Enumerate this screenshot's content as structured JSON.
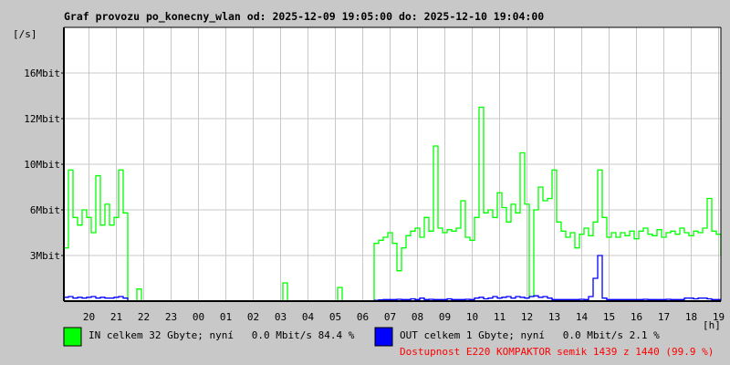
{
  "chart_data": {
    "type": "line",
    "title": "Graf provozu po_konecny_wlan od: 2025-12-09 19:05:00 do: 2025-12-10 19:04:00",
    "ylabel": "[/s]",
    "xlabel": "[h]",
    "yticks": [
      {
        "value": 3,
        "label": "3Mbit"
      },
      {
        "value": 6,
        "label": "6Mbit"
      },
      {
        "value": 10,
        "label": "10Mbit"
      },
      {
        "value": 12,
        "label": "12Mbit"
      },
      {
        "value": 16,
        "label": "16Mbit"
      }
    ],
    "ylim": [
      0,
      20
    ],
    "xticks": [
      "20",
      "21",
      "22",
      "23",
      "00",
      "01",
      "02",
      "03",
      "04",
      "05",
      "06",
      "07",
      "08",
      "09",
      "10",
      "11",
      "12",
      "13",
      "14",
      "15",
      "16",
      "17",
      "18",
      "19"
    ],
    "start_time": "19:05",
    "interval_min": 10,
    "grid": true,
    "series": [
      {
        "name": "IN",
        "color": "#00ff00",
        "values": [
          3.5,
          9.5,
          5.5,
          5,
          6,
          5.5,
          4.5,
          9,
          5,
          6.5,
          5,
          5.5,
          9.5,
          5.8,
          0,
          0,
          0.8,
          0,
          0,
          0,
          0,
          0,
          0,
          0,
          0,
          0,
          0,
          0,
          0,
          0,
          0,
          0,
          0,
          0,
          0,
          0,
          0,
          0,
          0,
          0,
          0,
          0,
          0,
          0,
          0,
          0,
          0,
          0,
          1.2,
          0,
          0,
          0,
          0,
          0,
          0,
          0,
          0,
          0,
          0,
          0,
          0.9,
          0,
          0,
          0,
          0,
          0,
          0,
          0,
          3.8,
          4,
          4.2,
          4.5,
          3.8,
          2.0,
          3.5,
          4.3,
          4.6,
          4.8,
          4.2,
          5.5,
          4.6,
          10.8,
          4.8,
          4.5,
          4.7,
          4.6,
          4.8,
          6.8,
          4.2,
          4.0,
          5.5,
          13,
          5.8,
          6,
          5.5,
          7.5,
          6.2,
          5.2,
          6.5,
          5.8,
          10.5,
          6.5,
          0.3,
          6,
          8,
          6.8,
          7,
          9.5,
          5.2,
          4.6,
          4.2,
          4.5,
          3.5,
          4.4,
          4.8,
          4.3,
          5.2,
          9.5,
          5.5,
          4.2,
          4.5,
          4.2,
          4.5,
          4.3,
          4.6,
          4.1,
          4.6,
          4.8,
          4.4,
          4.3,
          4.7,
          4.2,
          4.5,
          4.6,
          4.4,
          4.8,
          4.5,
          4.3,
          4.6,
          4.5,
          4.8,
          7,
          4.6,
          4.4,
          3.0
        ]
      },
      {
        "name": "OUT",
        "color": "#0000ff",
        "values": [
          0.25,
          0.3,
          0.2,
          0.25,
          0.2,
          0.25,
          0.3,
          0.2,
          0.25,
          0.2,
          0.2,
          0.25,
          0.3,
          0.2,
          0,
          0,
          0,
          0,
          0,
          0,
          0,
          0,
          0,
          0,
          0,
          0,
          0,
          0,
          0,
          0,
          0,
          0,
          0,
          0,
          0,
          0,
          0,
          0,
          0,
          0,
          0,
          0,
          0,
          0,
          0,
          0,
          0,
          0,
          0,
          0,
          0,
          0,
          0,
          0,
          0,
          0,
          0,
          0,
          0,
          0,
          0,
          0,
          0,
          0,
          0,
          0,
          0,
          0,
          0.05,
          0.08,
          0.1,
          0.1,
          0.1,
          0.12,
          0.1,
          0.1,
          0.15,
          0.1,
          0.2,
          0.1,
          0.12,
          0.1,
          0.1,
          0.1,
          0.15,
          0.1,
          0.1,
          0.1,
          0.12,
          0.1,
          0.2,
          0.25,
          0.15,
          0.2,
          0.3,
          0.2,
          0.25,
          0.3,
          0.2,
          0.3,
          0.25,
          0.2,
          0.3,
          0.35,
          0.25,
          0.3,
          0.2,
          0.1,
          0.1,
          0.1,
          0.1,
          0.1,
          0.1,
          0.12,
          0.1,
          0.3,
          1.5,
          3.0,
          0.2,
          0.1,
          0.1,
          0.1,
          0.1,
          0.1,
          0.1,
          0.1,
          0.1,
          0.12,
          0.1,
          0.1,
          0.1,
          0.1,
          0.12,
          0.1,
          0.1,
          0.1,
          0.2,
          0.2,
          0.15,
          0.2,
          0.2,
          0.15,
          0.1,
          0.1,
          0.1,
          0.1
        ]
      }
    ]
  },
  "legend": {
    "in_text": "IN celkem 32 Gbyte; nyní   0.0 Mbit/s 84.4 %",
    "out_text": "OUT celkem 1 Gbyte; nyní   0.0 Mbit/s 2.1 %",
    "availability": "Dostupnost E220 KOMPAKTOR semik 1439 z 1440 (99.9 %)"
  }
}
